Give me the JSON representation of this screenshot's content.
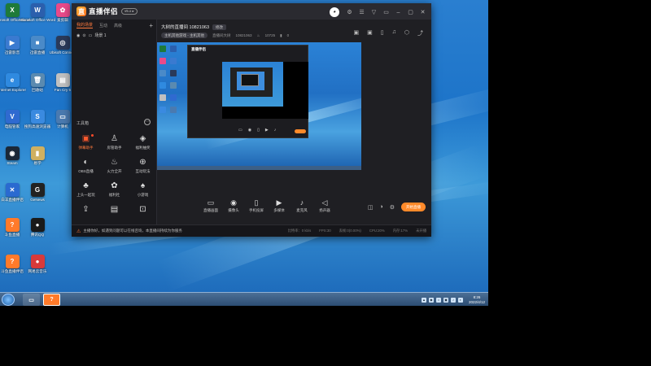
{
  "desktop": {
    "icons": [
      {
        "label": "Microsoft Office Excel",
        "glyph": "X",
        "color": "#1e7a3a"
      },
      {
        "label": "Microsoft Office Word",
        "glyph": "W",
        "color": "#2b5fad"
      },
      {
        "label": "爱剪辑",
        "glyph": "✿",
        "color": "#e84a8a"
      },
      {
        "label": "迅雷影音",
        "glyph": "▶",
        "color": "#3a7ad0"
      },
      {
        "label": "迅雷直播",
        "glyph": "■",
        "color": "#4a8ac8"
      },
      {
        "label": "Ubisoft Connect",
        "glyph": "◎",
        "color": "#2a3a5a"
      },
      {
        "label": "Internet Explorer",
        "glyph": "e",
        "color": "#2f8ae0"
      },
      {
        "label": "回收站",
        "glyph": "🗑",
        "color": "#5a8ab0"
      },
      {
        "label": "Fan Cry 5",
        "glyph": "▤",
        "color": "#c0c0c0"
      },
      {
        "label": "电脑管家",
        "glyph": "V",
        "color": "#2f6ad0"
      },
      {
        "label": "搜狗高速浏览器",
        "glyph": "S",
        "color": "#3a8ae0"
      },
      {
        "label": "计算机",
        "glyph": "▭",
        "color": "#4a7ab0"
      },
      {
        "label": "Steam",
        "glyph": "◉",
        "color": "#1b2838"
      },
      {
        "label": "易学",
        "glyph": "▮",
        "color": "#d0b060"
      },
      {
        "label": "白羊直播伴侣",
        "glyph": "✕",
        "color": "#2a6ad0"
      },
      {
        "label": "GeNews",
        "glyph": "G",
        "color": "#222222"
      },
      {
        "label": "斗鱼直播",
        "glyph": "?",
        "color": "#ff7a2a"
      },
      {
        "label": "腾讯QQ",
        "glyph": "●",
        "color": "#1a1a1a"
      },
      {
        "label": "斗鱼直播伴侣",
        "glyph": "?",
        "color": "#ff7a2a"
      },
      {
        "label": "网易云音乐",
        "glyph": "●",
        "color": "#d83a3a"
      }
    ]
  },
  "taskbar": {
    "items": [
      {
        "glyph": "▭",
        "color": "#4a7ab0"
      },
      {
        "glyph": "?",
        "color": "#ff7a2a"
      }
    ],
    "tray_icons": [
      "▲",
      "◆",
      "⌂",
      "▣",
      "♪",
      "◐"
    ],
    "time": "8:26",
    "date": "2022/4/12"
  },
  "app": {
    "name": "直播伴侣",
    "version_badge": "v5.x ▸",
    "window_controls": [
      "⚙",
      "☰",
      "▽",
      "▭",
      "–",
      "▢",
      "✕"
    ],
    "panel_tabs": [
      "我的场景",
      "互动",
      "高级"
    ],
    "panel_add": "+",
    "scene_name": "场景 1",
    "tools_header": "工具箱",
    "tools": [
      {
        "icon": "▣",
        "label": "弹幕助手",
        "hot": true
      },
      {
        "icon": "♙",
        "label": "房管助手",
        "hot": false
      },
      {
        "icon": "◈",
        "label": "福利抽奖",
        "hot": false
      },
      {
        "icon": "◐",
        "label": "OBS直播",
        "hot": false
      },
      {
        "icon": "♨",
        "label": "火力全开",
        "hot": false
      },
      {
        "icon": "⊕",
        "label": "互动玩法",
        "hot": false
      },
      {
        "icon": "♣",
        "label": "上头一起玩",
        "hot": false
      },
      {
        "icon": "✿",
        "label": "福利社",
        "hot": false
      },
      {
        "icon": "♠",
        "label": "小游戏",
        "hot": false
      },
      {
        "icon": "⇪",
        "label": "",
        "hot": false
      },
      {
        "icon": "▤",
        "label": "",
        "hot": false
      },
      {
        "icon": "⊡",
        "label": "",
        "hot": false
      }
    ],
    "room_title": "大树的直播间 10821063",
    "edit_label": "修改",
    "category": "主机其他游戏 - 主机其他",
    "room_name": "直播间大树",
    "room_id": "10821063",
    "views": "10725",
    "likes": "0",
    "header_icons": [
      "▣",
      "▣",
      "▯",
      "♫",
      "⬡",
      "⤴"
    ],
    "nested_title": "直播伴侣",
    "bottom_tools": [
      {
        "icon": "▭",
        "label": "直播画面"
      },
      {
        "icon": "◉",
        "label": "摄像头"
      },
      {
        "icon": "▯",
        "label": "手机投屏"
      },
      {
        "icon": "▶",
        "label": "多媒体"
      },
      {
        "icon": "♪",
        "label": "麦克风"
      },
      {
        "icon": "◁",
        "label": "扬声器"
      }
    ],
    "right_controls": [
      "◫",
      "◑",
      "⚙"
    ],
    "start_live": "开始直播",
    "status_icon": "⚠",
    "status_message": "主播你好，如遇到问题可以在线咨询，本直播间持续为你服务",
    "stats": [
      "比特率：0 kb/s",
      "FPS:30",
      "丢帧:0(0.00%)",
      "CPU:20%",
      "内存:17%",
      "未开播"
    ]
  }
}
